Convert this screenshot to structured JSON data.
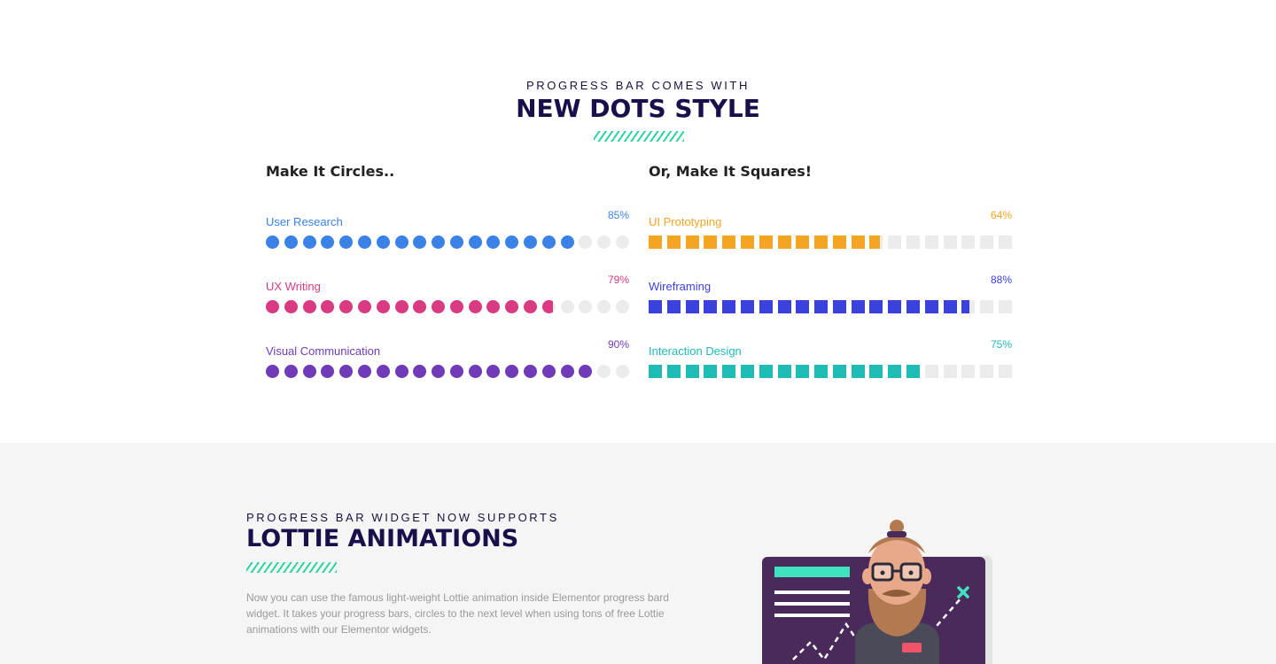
{
  "section1": {
    "eyebrow": "PROGRESS BAR COMES WITH",
    "title": "NEW DOTS STYLE",
    "circles": {
      "heading": "Make It Circles..",
      "bars": [
        {
          "label": "User Research",
          "percent_text": "85%",
          "value": 85,
          "color": "#3b82e8"
        },
        {
          "label": "UX Writing",
          "percent_text": "79%",
          "value": 79,
          "color": "#d93a82"
        },
        {
          "label": "Visual Communication",
          "percent_text": "90%",
          "value": 90,
          "color": "#6f3bb8"
        }
      ]
    },
    "squares": {
      "heading": "Or, Make It Squares!",
      "bars": [
        {
          "label": "UI Prototyping",
          "percent_text": "64%",
          "value": 64,
          "color": "#f4a623"
        },
        {
          "label": "Wireframing",
          "percent_text": "88%",
          "value": 88,
          "color": "#3a41dc"
        },
        {
          "label": "Interaction Design",
          "percent_text": "75%",
          "value": 75,
          "color": "#1ebcb5"
        }
      ]
    },
    "empty_color": "#ebebeb",
    "accent_color": "#2fd3a3"
  },
  "section2": {
    "eyebrow": "PROGRESS BAR WIDGET NOW SUPPORTS",
    "title": "LOTTIE ANIMATIONS",
    "body": "Now you can use the famous light-weight Lottie animation inside Elementor progress bard widget. It takes your progress bars, circles to the next level when using tons of free Lottie animations with our Elementor widgets."
  }
}
